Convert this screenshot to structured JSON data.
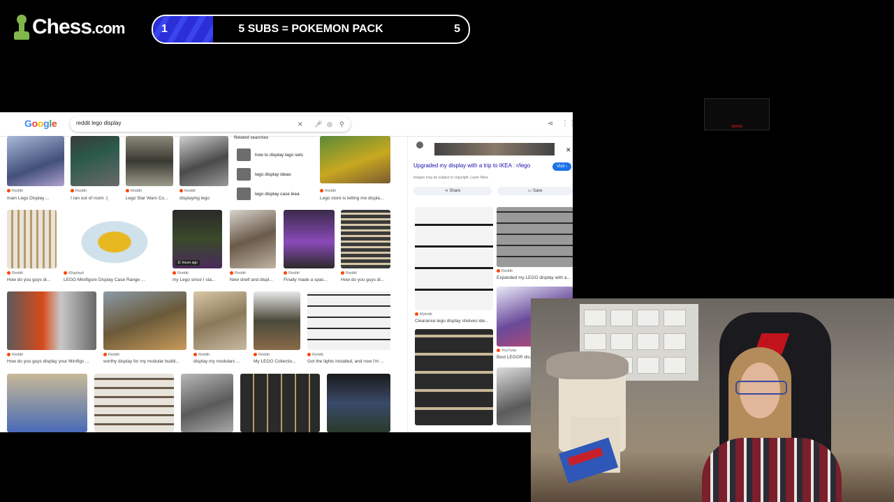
{
  "overlay": {
    "logo_text": "Chess",
    "logo_suffix": ".com",
    "goal_current": "1",
    "goal_label": "5 SUBS = POKEMON PACK",
    "goal_target": "5",
    "goal_progress": 0.2
  },
  "google": {
    "query": "reddit lego display"
  },
  "related": {
    "heading": "Related searches",
    "items": [
      "how to display lego sets",
      "lego display ideas",
      "lego display case ikea"
    ]
  },
  "results": [
    {
      "source": "Reddit",
      "title": "main Lego Display ..."
    },
    {
      "source": "Reddit",
      "title": "I ran out of room :("
    },
    {
      "source": "Reddit",
      "title": "Lego Star Wars Co..."
    },
    {
      "source": "Reddit",
      "title": "displaying lego"
    },
    {
      "source": "Reddit",
      "title": "Lego store is letting me displa..."
    },
    {
      "source": "Reddit",
      "title": "How do you guys di..."
    },
    {
      "source": "iDisplayit",
      "title": "LEGO Minifigure Display Case Range ..."
    },
    {
      "source": "Reddit",
      "title": "my Lego since I sta...",
      "badge": "11 hours ago"
    },
    {
      "source": "Reddit",
      "title": "New shelf and displ..."
    },
    {
      "source": "Reddit",
      "title": "Finally made a spac..."
    },
    {
      "source": "Reddit",
      "title": "How do you guys di..."
    },
    {
      "source": "Reddit",
      "title": "How do you guys display your Minifigs ..."
    },
    {
      "source": "Reddit",
      "title": "worthy display for my modular buildi..."
    },
    {
      "source": "Reddit",
      "title": "display my modulars ..."
    },
    {
      "source": "Reddit",
      "title": "My LEGO Collectio..."
    },
    {
      "source": "Reddit",
      "title": "Got the lights installed, and now I'm ..."
    }
  ],
  "panel": {
    "title": "Upgraded my display with a trip to IKEA : r/lego",
    "visit": "Visit",
    "note": "Images may be subject to copyright. Learn More",
    "share": "Share",
    "save": "Save",
    "related": [
      {
        "source": "Reddit",
        "title": "Expanded my LEGO display with a..."
      },
      {
        "source": "Mykotti",
        "title": "Clearance lego display shelves ide..."
      },
      {
        "source": "YouTube",
        "title": "Best LEGO® dis..."
      }
    ]
  }
}
